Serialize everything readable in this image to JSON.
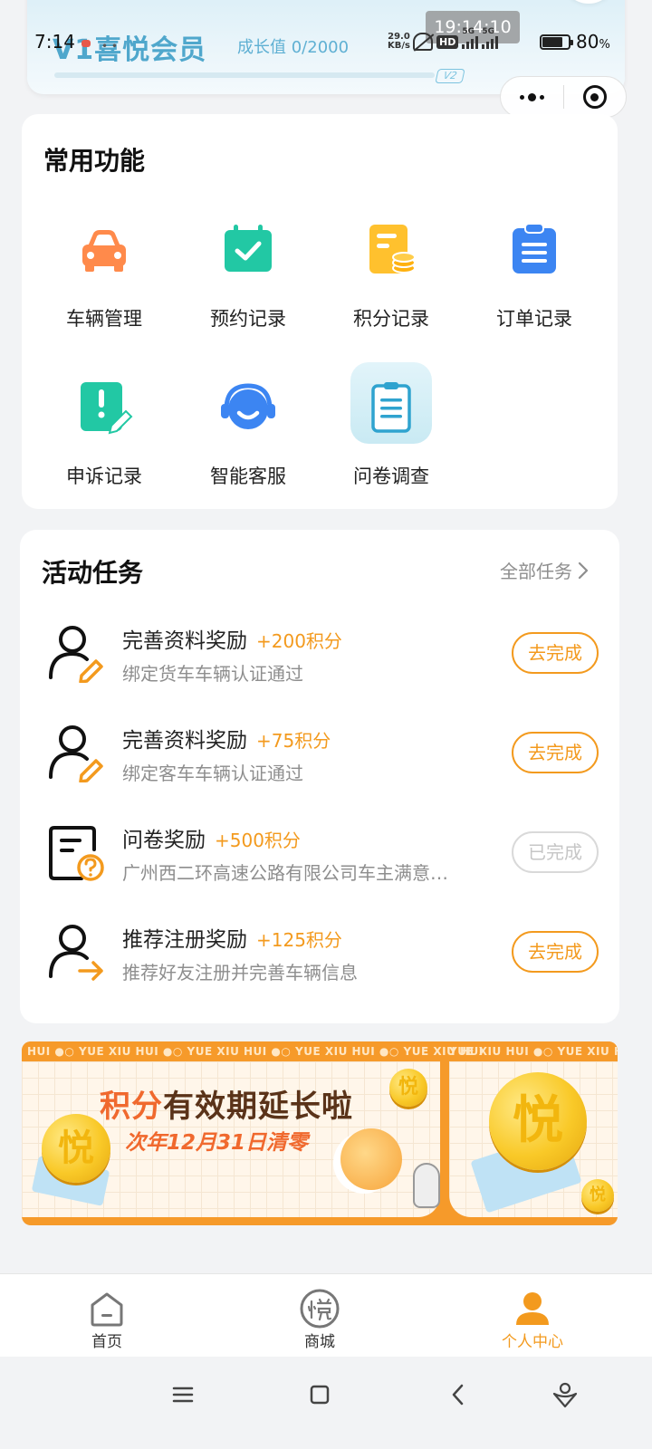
{
  "status_bar": {
    "time": "7:14",
    "overlay_time": "19:14:10",
    "net_speed_value": "29.0",
    "net_speed_unit": "KB/s",
    "hd_label": "HD",
    "signal_1": "5G",
    "signal_2": "5G",
    "battery_value": "80",
    "battery_unit": "%"
  },
  "member": {
    "title": "V1喜悦会员",
    "growth": "成长值 0/2000",
    "next_level": "V2"
  },
  "functions": {
    "title": "常用功能",
    "items": [
      {
        "label": "车辆管理",
        "icon": "car-icon"
      },
      {
        "label": "预约记录",
        "icon": "calendar-check-icon"
      },
      {
        "label": "积分记录",
        "icon": "points-record-icon"
      },
      {
        "label": "订单记录",
        "icon": "clipboard-icon"
      },
      {
        "label": "申诉记录",
        "icon": "appeal-icon"
      },
      {
        "label": "智能客服",
        "icon": "headset-icon"
      },
      {
        "label": "问卷调查",
        "icon": "survey-icon"
      }
    ]
  },
  "tasks": {
    "title": "活动任务",
    "all_label": "全部任务",
    "items": [
      {
        "title": "完善资料奖励",
        "points": "+200积分",
        "desc": "绑定货车车辆认证通过",
        "button": "去完成",
        "done": false,
        "icon": "user-edit-icon"
      },
      {
        "title": "完善资料奖励",
        "points": "+75积分",
        "desc": "绑定客车车辆认证通过",
        "button": "去完成",
        "done": false,
        "icon": "user-edit-icon"
      },
      {
        "title": "问卷奖励",
        "points": "+500积分",
        "desc": "广州西二环高速公路有限公司车主满意度调查",
        "button": "已完成",
        "done": true,
        "icon": "questionnaire-icon"
      },
      {
        "title": "推荐注册奖励",
        "points": "+125积分",
        "desc": "推荐好友注册并完善车辆信息",
        "button": "去完成",
        "done": false,
        "icon": "user-invite-icon"
      }
    ]
  },
  "banner": {
    "strip_text": "HUI ●○ YUE XIU HUI ●○ YUE XIU HUI ●○ YUE XIU HUI ●○ YUE XIU HUI",
    "strip_text_right": "YUE XIU HUI ●○ YUE XIU HUI",
    "headline_highlight": "积分",
    "headline_rest": "有效期延长啦",
    "subline": "次年12月31日清零",
    "coin_char": "悦"
  },
  "tabbar": {
    "items": [
      {
        "label": "首页",
        "icon": "home-icon",
        "active": false
      },
      {
        "label": "商城",
        "icon": "mall-icon",
        "active": false
      },
      {
        "label": "个人中心",
        "icon": "profile-icon",
        "active": true
      }
    ]
  },
  "colors": {
    "accent": "#f39a1e",
    "member_blue": "#4fa7cc",
    "background": "#f2f3f5"
  }
}
